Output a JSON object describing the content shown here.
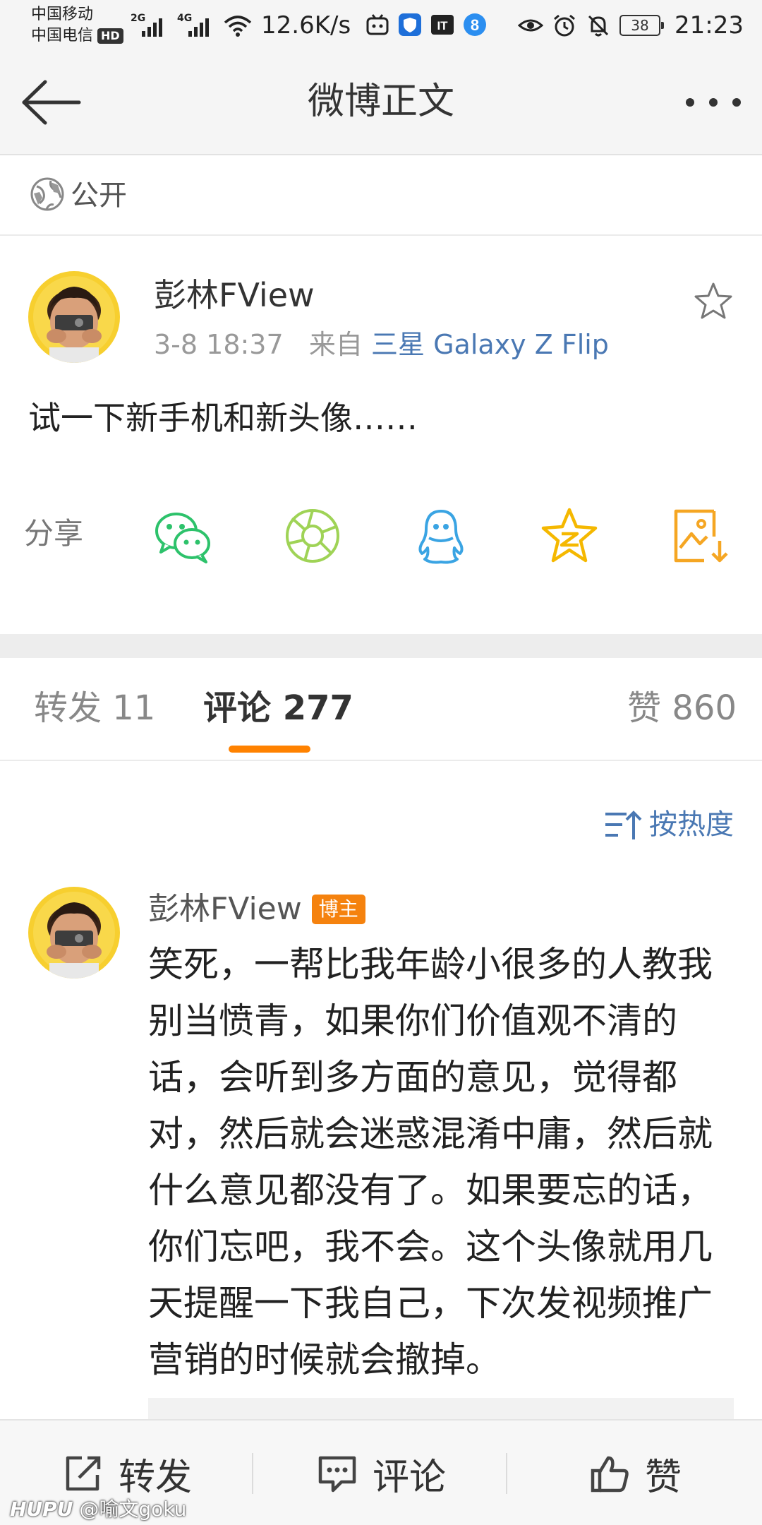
{
  "status_bar": {
    "carrier1": "中国移动",
    "carrier2": "中国电信",
    "hd_badge": "HD",
    "signal1_label": "2G",
    "signal2_label": "4G",
    "net_speed": "12.6K/s",
    "battery": "38",
    "time": "21:23"
  },
  "nav": {
    "title": "微博正文"
  },
  "visibility": {
    "label": "公开"
  },
  "post": {
    "author": "彭林FView",
    "date": "3-8 18:37",
    "from_prefix": "来自",
    "source": "三星 Galaxy Z Flip",
    "text": "试一下新手机和新头像……"
  },
  "share": {
    "label": "分享",
    "targets": [
      "wechat-icon",
      "moments-icon",
      "qq-icon",
      "qzone-icon",
      "save-image-icon"
    ]
  },
  "tabs": {
    "repost": "转发 11",
    "comments": "评论 277",
    "likes": "赞 860"
  },
  "sort": {
    "label": "按热度"
  },
  "comment": {
    "author": "彭林FView",
    "badge": "博主",
    "text": "笑死，一帮比我年龄小很多的人教我别当愤青，如果你们价值观不清的话，会听到多方面的意见，觉得都对，然后就会迷惑混淆中庸，然后就什么意见都没有了。如果要忘的话，你们忘吧，我不会。这个头像就用几天提醒一下我自己，下次发视频推广营销的时候就会撤掉。"
  },
  "bottom_bar": {
    "repost": "转发",
    "comment": "评论",
    "like": "赞"
  },
  "watermark": {
    "logo": "HUPU",
    "handle": "@喻文goku"
  },
  "colors": {
    "accent_orange": "#ff8200",
    "link_blue": "#4a78b3",
    "wechat_green": "#2dc26b",
    "moments_green": "#9fd356",
    "qq_blue": "#3aa4e3",
    "qzone_yellow": "#f5b800",
    "save_orange": "#f5a623"
  }
}
